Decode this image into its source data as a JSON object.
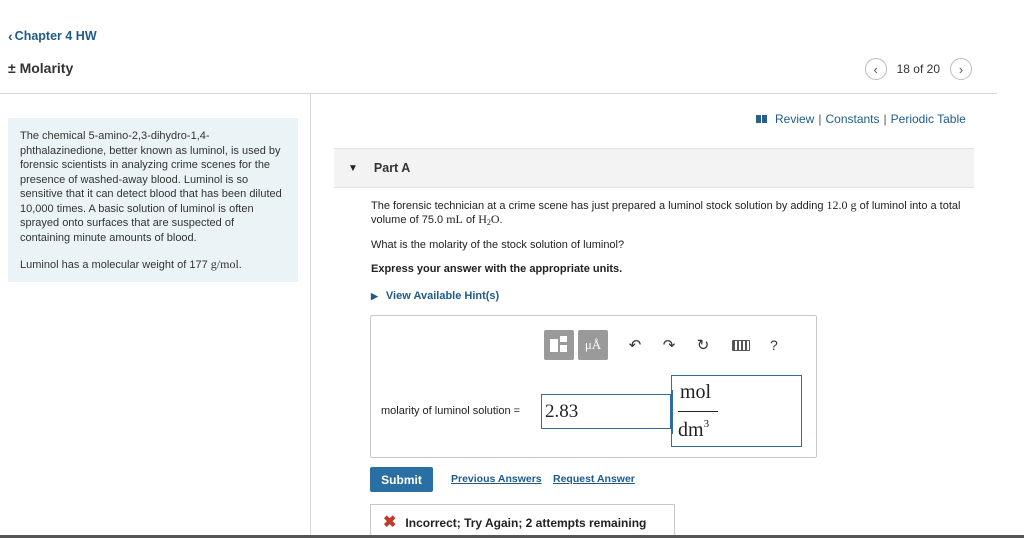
{
  "header": {
    "back_label": "Chapter 4 HW",
    "title": "Molarity",
    "title_prefix": "±",
    "pager_text": "18 of 20"
  },
  "intro": {
    "paragraph1": "The chemical 5-amino-2,3-dihydro-1,4-phthalazinedione, better known as luminol, is used by forensic scientists in analyzing crime scenes for the presence of washed-away blood. Luminol is so sensitive that it can detect blood that has been diluted 10,000 times. A basic solution of luminol is often sprayed onto surfaces that are suspected of containing minute amounts of blood.",
    "paragraph2_prefix": "Luminol has a molecular weight of 177 ",
    "paragraph2_unit": "g/mol",
    "paragraph2_suffix": "."
  },
  "links": {
    "review": "Review",
    "constants": "Constants",
    "periodic_table": "Periodic Table",
    "separator": "|"
  },
  "part": {
    "label": "Part A"
  },
  "question": {
    "text_a": "The forensic technician at a crime scene has just prepared a luminol stock solution by adding ",
    "mass": "12.0 g",
    "text_b": " of luminol into a total volume of 75.0 ",
    "volume_unit": "mL",
    "text_c": " of ",
    "solvent_h": "H",
    "solvent_sub": "2",
    "solvent_o": "O",
    "text_d": ".",
    "ask": "What is the molarity of the stock solution of luminol?",
    "instruction": "Express your answer with the appropriate units.",
    "hints_label": "View Available Hint(s)"
  },
  "answer": {
    "label": "molarity of luminol solution =",
    "value": "2.83",
    "unit_numerator": "mol",
    "unit_denominator": "dm",
    "unit_exponent": "3",
    "toolbar": {
      "mu_a_label": "μÅ",
      "help_label": "?"
    }
  },
  "actions": {
    "submit": "Submit",
    "previous_answers": "Previous Answers",
    "request_answer": "Request Answer"
  },
  "feedback": {
    "message": "Incorrect; Try Again; 2 attempts remaining"
  },
  "colors": {
    "link": "#1f5b8a",
    "submit_bg": "#2a6fa4",
    "intro_bg": "#eaf4f7",
    "error": "#c0392b"
  }
}
